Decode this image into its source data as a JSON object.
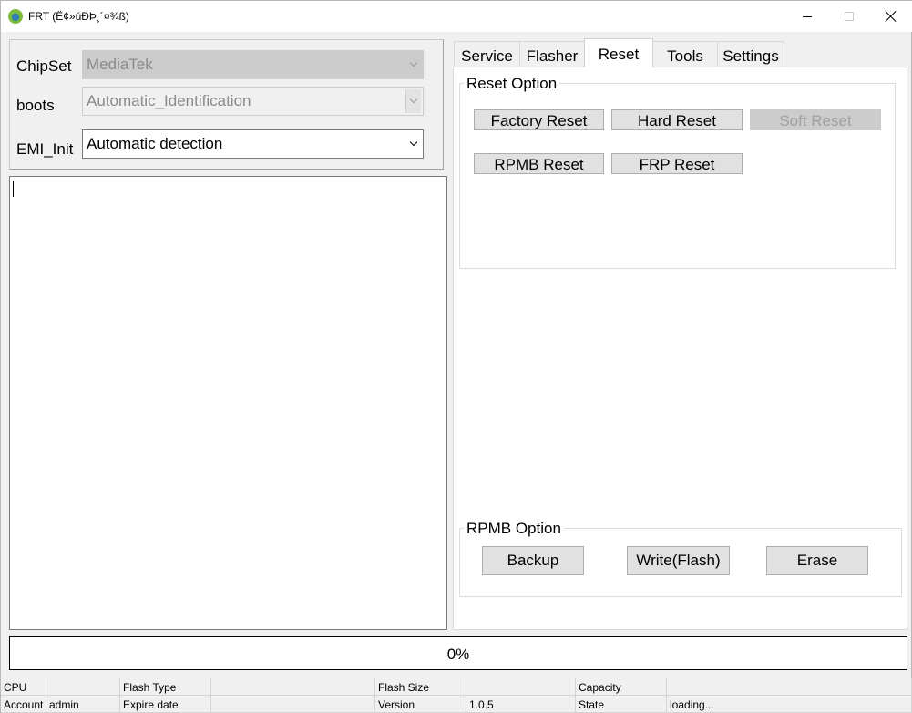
{
  "window": {
    "title": "FRT (Ë¢»úÐÞ¸´¤¾ß)",
    "minimize_label": "",
    "maximize_label": "",
    "close_label": ""
  },
  "config": {
    "chipset_label": "ChipSet",
    "chipset_value": "MediaTek",
    "boots_label": "boots",
    "boots_value": "Automatic_Identification",
    "emi_label": "EMI_Init",
    "emi_value": "Automatic detection"
  },
  "log": {
    "text": ""
  },
  "tabs": [
    {
      "label": "Service"
    },
    {
      "label": "Flasher"
    },
    {
      "label": "Reset"
    },
    {
      "label": "Tools"
    },
    {
      "label": "Settings"
    }
  ],
  "reset_option": {
    "title": "Reset Option",
    "factory_reset": "Factory Reset",
    "hard_reset": "Hard Reset",
    "soft_reset": "Soft Reset",
    "rpmb_reset": "RPMB Reset",
    "frp_reset": "FRP Reset"
  },
  "rpmb_option": {
    "title": "RPMB Option",
    "backup": "Backup",
    "write": "Write(Flash)",
    "erase": "Erase"
  },
  "progress": {
    "text": "0%",
    "value": 0
  },
  "statusbar": {
    "cpu_label": "CPU",
    "cpu_value": "",
    "flash_type_label": "Flash Type",
    "flash_type_value": "",
    "flash_size_label": "Flash Size",
    "flash_size_value": "",
    "capacity_label": "Capacity",
    "capacity_value": "",
    "account_label": "Account",
    "account_value": "admin",
    "expire_label": "Expire date",
    "expire_value": "",
    "version_label": "Version",
    "version_value": "1.0.5",
    "state_label": "State",
    "state_value": "loading..."
  }
}
